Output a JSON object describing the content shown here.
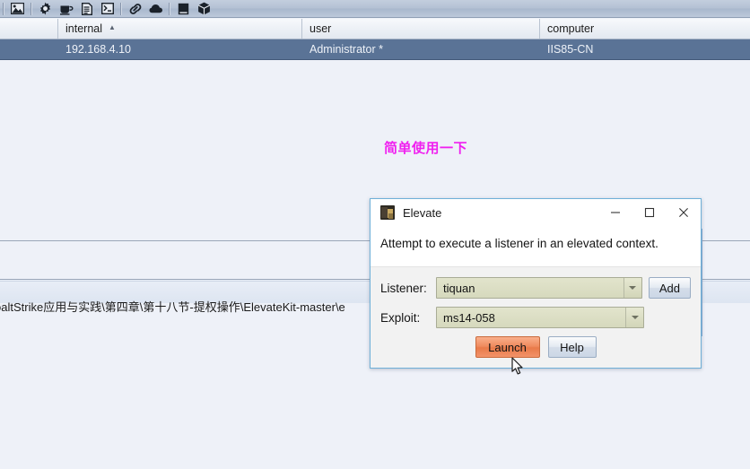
{
  "toolbar": {
    "icons": [
      {
        "name": "image-icon",
        "glyph": "image"
      },
      {
        "name": "gear-icon",
        "glyph": "gear"
      },
      {
        "name": "coffee-cup-icon",
        "glyph": "cup"
      },
      {
        "name": "document-icon",
        "glyph": "document"
      },
      {
        "name": "terminal-icon",
        "glyph": "terminal"
      },
      {
        "name": "link-icon",
        "glyph": "link"
      },
      {
        "name": "cloud-icon",
        "glyph": "cloud"
      },
      {
        "name": "book-icon",
        "glyph": "book"
      },
      {
        "name": "cube-icon",
        "glyph": "cube"
      }
    ]
  },
  "table": {
    "columns": [
      {
        "key": "internal",
        "label": "internal",
        "sort": "asc",
        "sort_glyph": "▲"
      },
      {
        "key": "user",
        "label": "user",
        "sort": "none",
        "sort_glyph": ""
      },
      {
        "key": "computer",
        "label": "computer",
        "sort": "none",
        "sort_glyph": ""
      }
    ],
    "rows": [
      {
        "internal": "192.168.4.10",
        "user": "Administrator *",
        "computer": "IIS85-CN",
        "selected": true
      }
    ]
  },
  "annotation": {
    "text": "简单使用一下",
    "color": "#f020f0"
  },
  "path_field": {
    "text": "oaltStrike应用与实践\\第四章\\第十八节-提权操作\\ElevateKit-master\\e"
  },
  "dialog": {
    "title": "Elevate",
    "message": "Attempt to execute a listener in an elevated context.",
    "window_controls": [
      {
        "name": "minimize-button",
        "glyph": "minimize"
      },
      {
        "name": "maximize-button",
        "glyph": "maximize"
      },
      {
        "name": "close-button",
        "glyph": "close"
      }
    ],
    "fields": [
      {
        "name": "listener",
        "label": "Listener:",
        "value": "tiquan"
      },
      {
        "name": "exploit",
        "label": "Exploit:",
        "value": "ms14-058"
      }
    ],
    "add_label": "Add",
    "launch_label": "Launch",
    "help_label": "Help",
    "accent_launch": "#e97a49",
    "border_color": "#6fb0d8"
  }
}
